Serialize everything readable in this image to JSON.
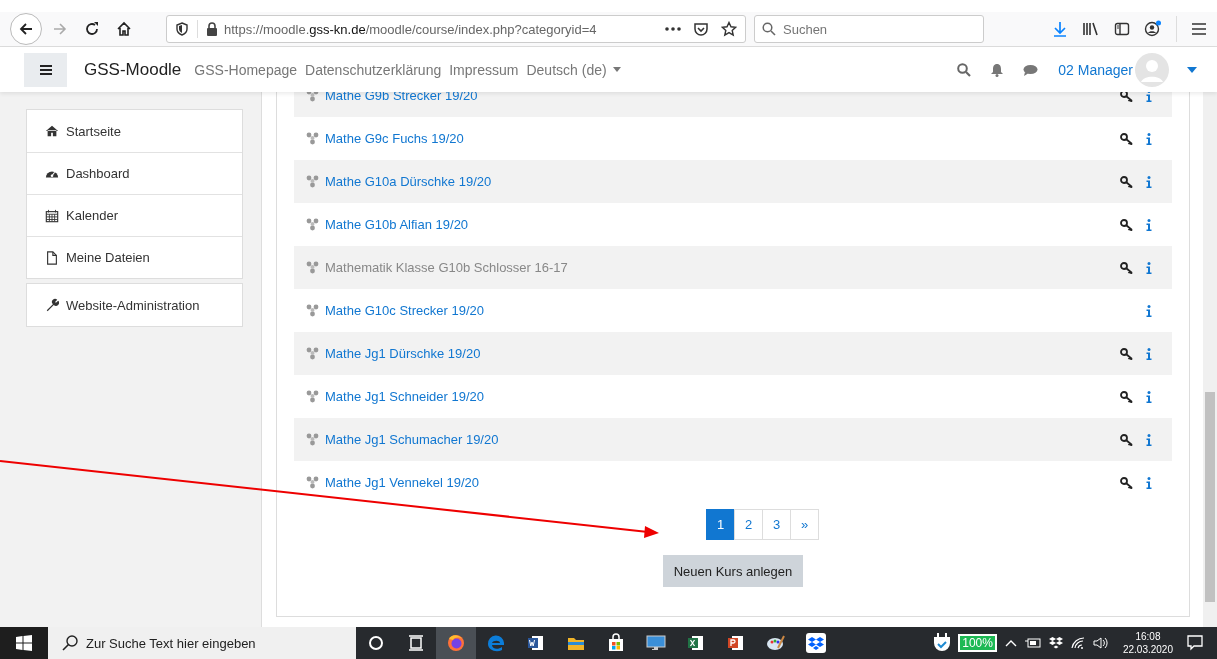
{
  "browser": {
    "url_prefix": "https://moodle.",
    "url_domain": "gss-kn.de",
    "url_path": "/moodle/course/index.php?categoryid=4",
    "search_placeholder": "Suchen"
  },
  "navbar": {
    "site_name": "GSS-Moodle",
    "links": [
      "GSS-Homepage",
      "Datenschutzerklärung",
      "Impressum"
    ],
    "language": "Deutsch (de)",
    "user": "02 Manager"
  },
  "sidebar": {
    "blocks": [
      [
        {
          "label": "Startseite",
          "kind": "home"
        },
        {
          "label": "Dashboard",
          "kind": "dashboard"
        },
        {
          "label": "Kalender",
          "kind": "calendar"
        },
        {
          "label": "Meine Dateien",
          "kind": "file"
        }
      ],
      [
        {
          "label": "Website-Administration",
          "kind": "wrench"
        }
      ]
    ]
  },
  "courses": [
    {
      "name": "Mathe G9b Strecker 19/20",
      "dimmed": false,
      "key": true
    },
    {
      "name": "Mathe G9c Fuchs 19/20",
      "dimmed": false,
      "key": true
    },
    {
      "name": "Mathe G10a Dürschke 19/20",
      "dimmed": false,
      "key": true
    },
    {
      "name": "Mathe G10b Alfian 19/20",
      "dimmed": false,
      "key": true
    },
    {
      "name": "Mathematik Klasse G10b Schlosser 16-17",
      "dimmed": true,
      "key": true
    },
    {
      "name": "Mathe G10c Strecker 19/20",
      "dimmed": false,
      "key": false
    },
    {
      "name": "Mathe Jg1 Dürschke 19/20",
      "dimmed": false,
      "key": true
    },
    {
      "name": "Mathe Jg1 Schneider 19/20",
      "dimmed": false,
      "key": true
    },
    {
      "name": "Mathe Jg1 Schumacher 19/20",
      "dimmed": false,
      "key": true
    },
    {
      "name": "Mathe Jg1 Vennekel 19/20",
      "dimmed": false,
      "key": true
    }
  ],
  "pagination": [
    {
      "label": "1",
      "selected": true
    },
    {
      "label": "2",
      "selected": false
    },
    {
      "label": "3",
      "selected": false
    },
    {
      "label": "»",
      "selected": false
    }
  ],
  "new_course_button": "Neuen Kurs anlegen",
  "taskbar": {
    "search_placeholder": "Zur Suche Text hier eingeben",
    "apps": [
      {
        "kind": "cortana",
        "active": false
      },
      {
        "kind": "taskview",
        "active": false
      },
      {
        "kind": "firefox",
        "active": true
      },
      {
        "kind": "edge",
        "active": false
      },
      {
        "kind": "word",
        "active": false
      },
      {
        "kind": "explorer",
        "active": false
      },
      {
        "kind": "store",
        "active": false
      },
      {
        "kind": "monitor",
        "active": false
      },
      {
        "kind": "excel",
        "active": false
      },
      {
        "kind": "powerpoint",
        "active": false
      },
      {
        "kind": "paint",
        "active": false
      },
      {
        "kind": "dropbox",
        "active": false
      }
    ],
    "battery": "100%",
    "time": "16:08",
    "date": "22.03.2020"
  }
}
